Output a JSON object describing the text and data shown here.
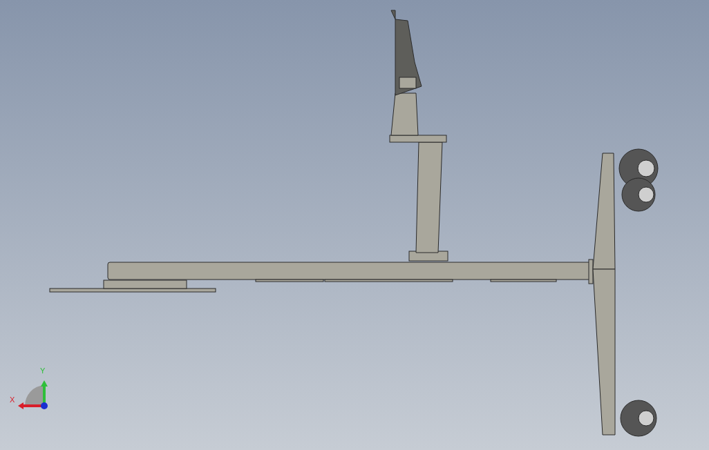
{
  "viewport": {
    "triad": {
      "axes": [
        {
          "label": "X",
          "color": "#d81e2a"
        },
        {
          "label": "Y",
          "color": "#2fbf3a"
        }
      ]
    }
  }
}
